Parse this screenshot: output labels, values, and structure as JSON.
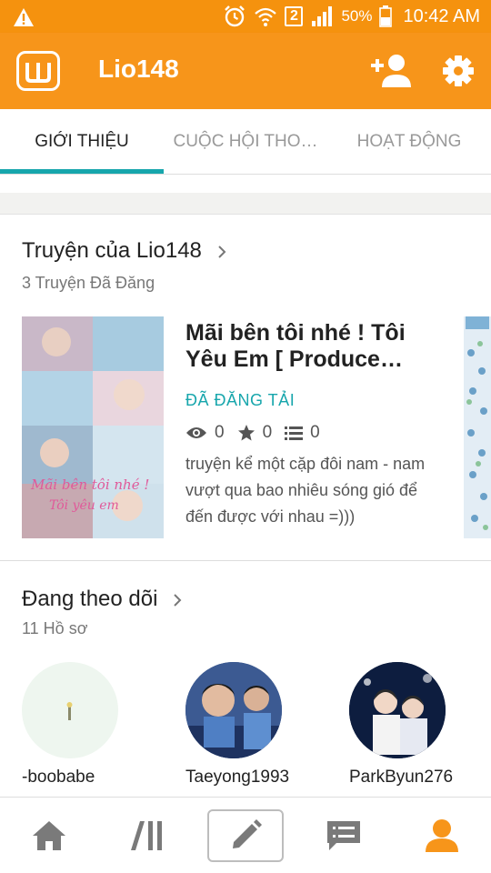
{
  "status_bar": {
    "sim_label": "2",
    "battery": "50%",
    "time": "10:42 AM",
    "icons": [
      "warning-icon",
      "alarm-icon",
      "wifi-icon",
      "signal-icon",
      "battery-icon"
    ]
  },
  "app_bar": {
    "title": "Lio148",
    "icons": [
      "app-logo-icon",
      "add-user-icon",
      "settings-icon"
    ],
    "color": "#f7951a"
  },
  "tabs": [
    {
      "label": "GIỚI THIỆU",
      "active": true
    },
    {
      "label": "CUỘC HỘI THO…",
      "active": false
    },
    {
      "label": "HOẠT ĐỘNG",
      "active": false
    }
  ],
  "accent_color": "#17a6ac",
  "stories": {
    "title": "Truyện của Lio148",
    "subtitle": "3 Truyện Đã Đăng",
    "items": [
      {
        "title": "Mãi bên tôi nhé ! Tôi Yêu Em [ Produce…",
        "status": "ĐÃ ĐĂNG TẢI",
        "views": "0",
        "votes": "0",
        "parts": "0",
        "description": "truyện kể một cặp đôi nam - nam vượt qua bao nhiêu sóng gió để đến được với nhau =)))",
        "cover_text_1": "Mãi bên tôi nhé !",
        "cover_text_2": "Tôi yêu em"
      }
    ]
  },
  "following": {
    "title": "Đang theo dõi",
    "subtitle": "11 Hồ sơ",
    "profiles": [
      {
        "name": "-boobabe"
      },
      {
        "name": "Taeyong1993"
      },
      {
        "name": "ParkByun276"
      }
    ]
  },
  "bottom_nav": {
    "items": [
      "home-icon",
      "library-icon",
      "write-icon",
      "messages-icon",
      "profile-icon"
    ],
    "active": "profile-icon"
  }
}
